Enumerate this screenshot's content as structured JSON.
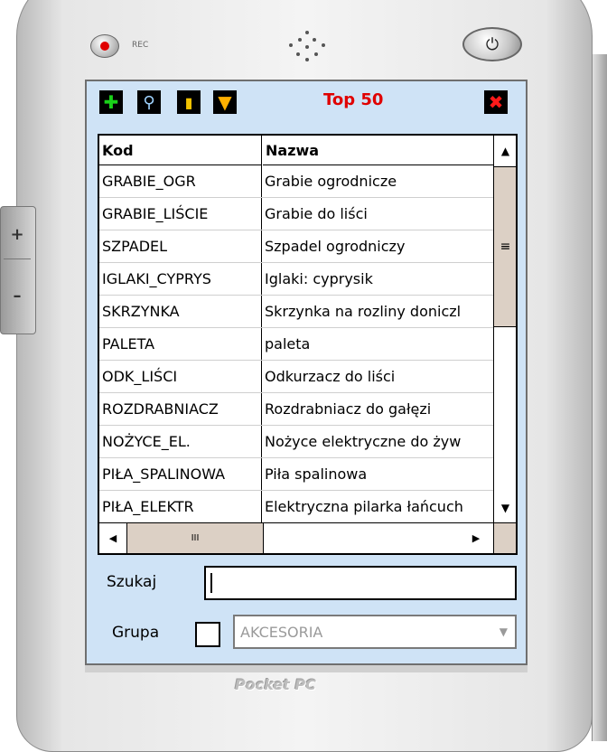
{
  "device": {
    "rec_label": "REC",
    "power_icon": "power-icon",
    "side_plus": "+",
    "side_minus": "–",
    "brand": "Pocket PC"
  },
  "toolbar": {
    "title": "Top 50",
    "icons": [
      "add-icon",
      "search-icon",
      "database-icon",
      "filter-icon",
      "close-icon"
    ]
  },
  "grid": {
    "columns": [
      "Kod",
      "Nazwa"
    ],
    "rows": [
      {
        "kod": "GRABIE_OGR",
        "nazwa": "Grabie ogrodnicze"
      },
      {
        "kod": "GRABIE_LIŚCIE",
        "nazwa": "Grabie do liści"
      },
      {
        "kod": "SZPADEL",
        "nazwa": "Szpadel ogrodniczy"
      },
      {
        "kod": "IGLAKI_CYPRYS",
        "nazwa": "Iglaki: cyprysik"
      },
      {
        "kod": "SKRZYNKA",
        "nazwa": "Skrzynka na rozliny doniczl"
      },
      {
        "kod": "PALETA",
        "nazwa": "paleta"
      },
      {
        "kod": "ODK_LIŚCI",
        "nazwa": "Odkurzacz do liści"
      },
      {
        "kod": "ROZDRABNIACZ",
        "nazwa": "Rozdrabniacz do gałęzi"
      },
      {
        "kod": "NOŻYCE_EL.",
        "nazwa": "Nożyce elektryczne do żyw"
      },
      {
        "kod": "PIŁA_SPALINOWA",
        "nazwa": "Piła spalinowa"
      },
      {
        "kod": "PIŁA_ELEKTR",
        "nazwa": "Elektryczna pilarka łańcuch"
      }
    ],
    "hscroll_thumb_label": "III",
    "vscroll_thumb_label": "≡"
  },
  "search": {
    "label": "Szukaj",
    "value": ""
  },
  "group": {
    "label": "Grupa",
    "checked": false,
    "selected": "AKCESORIA"
  }
}
